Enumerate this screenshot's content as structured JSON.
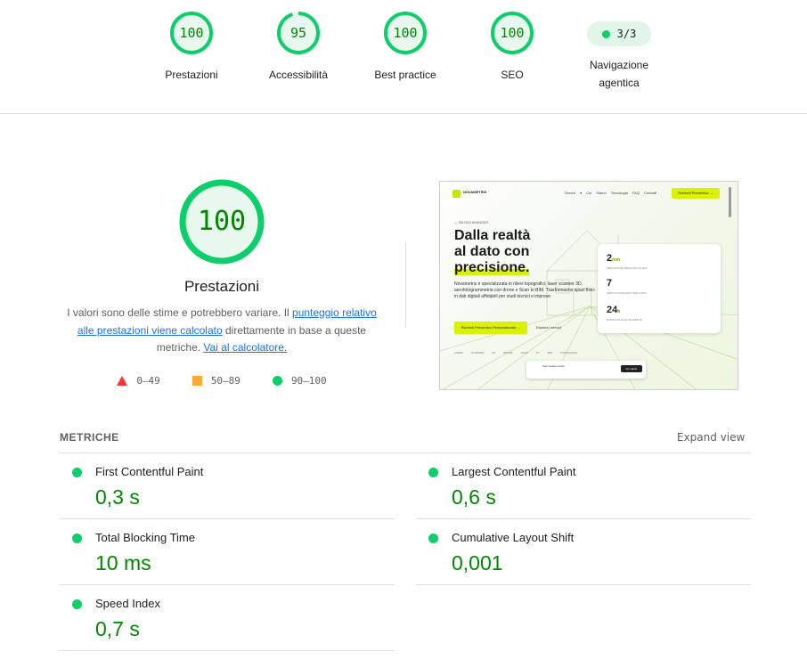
{
  "categories": [
    {
      "score": "100",
      "label": "Prestazioni",
      "fraction": 1.0
    },
    {
      "score": "95",
      "label": "Accessibilità",
      "fraction": 0.95
    },
    {
      "score": "100",
      "label": "Best practice",
      "fraction": 1.0
    },
    {
      "score": "100",
      "label": "SEO",
      "fraction": 1.0
    }
  ],
  "agentic": {
    "value": "3/3",
    "label": "Navigazione agentica"
  },
  "performance": {
    "score": "100",
    "title": "Prestazioni",
    "desc_part1": "I valori sono delle stime e potrebbero variare. Il ",
    "desc_link": "punteggio relativo alle prestazioni viene calcolato",
    "desc_part2": " direttamente in base a queste metriche. ",
    "calc_link": "Vai al calcolatore."
  },
  "legend": {
    "fail": "0–49",
    "average": "50–89",
    "pass": "90–100"
  },
  "colors": {
    "pass": "#0cce6b",
    "pass_text": "#008800",
    "average": "#ffaa33",
    "fail": "#ff3333"
  },
  "thumbnail": {
    "brand": "NOVAMETRIX",
    "nav": "Servizi ▾ Chi Siamo Tecnologia FAQ Contatti",
    "cta": "Richiedi Preventivo →",
    "kicker": "— RILIEVI AVANZATI",
    "hero_line1": "Dalla realtà",
    "hero_line2": "al dato con",
    "hero_line3": "precisione.",
    "paragraph": "Novametrix è specializzata in rilievi topografici, laser scanner 3D, aerofotogrammetria con drone e Scan to BIM. Trasformiamo spazi fisici in dati digitali affidabili per studi tecnici e imprese.",
    "button_primary": "Richiedi Preventivo Personalizzato →",
    "button_secondary": "Esplora i servizi",
    "stat1": "2",
    "stat1_unit": "mm",
    "stat1_label": "PRECISIONE MEDIA DEI RILIEVI",
    "stat2": "7",
    "stat2_label": "SERVIZI INTEGRATI PER IL BIM",
    "stat3": "24",
    "stat3_unit": "h",
    "stat3_label": "RISPOSTA ALLE RICHIESTE",
    "strip": "LASER SCANNER 3D DRONE SCAN TO BIM TOPOGRAFIA",
    "cookie_text": "Solo cookie tecnici",
    "cookie_button": "Ho capito"
  },
  "metrics": {
    "heading": "METRICHE",
    "expand": "Expand view",
    "items": [
      {
        "title": "First Contentful Paint",
        "value": "0,3 s"
      },
      {
        "title": "Largest Contentful Paint",
        "value": "0,6 s"
      },
      {
        "title": "Total Blocking Time",
        "value": "10 ms"
      },
      {
        "title": "Cumulative Layout Shift",
        "value": "0,001"
      },
      {
        "title": "Speed Index",
        "value": "0,7 s"
      }
    ]
  }
}
